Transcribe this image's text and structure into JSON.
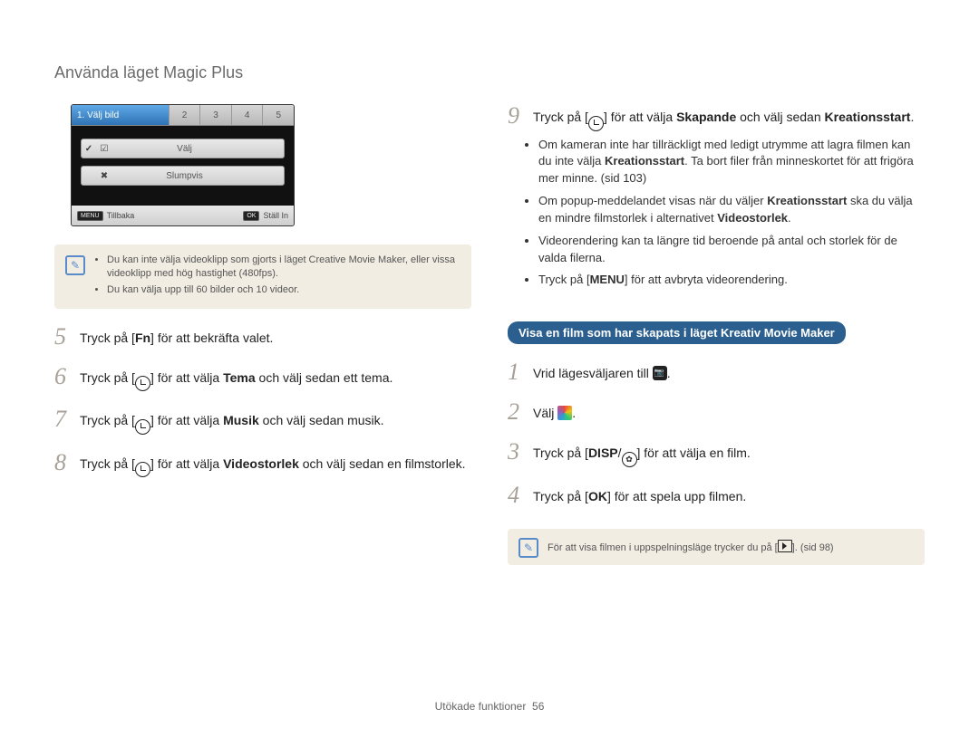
{
  "header": {
    "title": "Använda läget Magic Plus"
  },
  "cam_ui": {
    "tabs": {
      "active": "1. Välj bild",
      "others": [
        "2",
        "3",
        "4",
        "5"
      ]
    },
    "rows": [
      {
        "mark": "✓",
        "icon": "☑",
        "label": "Välj"
      },
      {
        "mark": "✖",
        "icon": "✖",
        "label": "Slumpvis"
      }
    ],
    "footer": {
      "menu_btn": "MENU",
      "back": "Tillbaka",
      "ok_btn": "OK",
      "set": "Ställ In"
    }
  },
  "note1": {
    "items": [
      "Du kan inte välja videoklipp som gjorts i läget Creative Movie Maker, eller vissa videoklipp med hög hastighet (480fps).",
      "Du kan välja upp till 60 bilder och 10 videor."
    ]
  },
  "steps_left": [
    {
      "n": "5",
      "pre": "Tryck på [",
      "key": "Fn",
      "post": "] för att bekräfta valet."
    },
    {
      "n": "6",
      "pre": "Tryck på [",
      "key_type": "timer",
      "mid": "] för att välja ",
      "bold": "Tema",
      "post": " och välj sedan ett tema."
    },
    {
      "n": "7",
      "pre": "Tryck på [",
      "key_type": "timer",
      "mid": "] för att välja ",
      "bold": "Musik",
      "post": " och välj sedan musik."
    },
    {
      "n": "8",
      "pre": "Tryck på [",
      "key_type": "timer",
      "mid": "] för att välja ",
      "bold": "Videostorlek",
      "post": " och välj sedan en filmstorlek."
    }
  ],
  "step9": {
    "n": "9",
    "pre": "Tryck på [",
    "mid1": "] för att välja ",
    "bold1": "Skapande",
    "mid2": " och välj sedan ",
    "bold2": "Kreationsstart",
    "post": ".",
    "sub": [
      {
        "t1": "Om kameran inte har tillräckligt med ledigt utrymme att lagra filmen kan du inte välja ",
        "b1": "Kreationsstart",
        "t2": ". Ta bort filer från minneskortet för att frigöra mer minne. (sid 103)"
      },
      {
        "t1": "Om popup-meddelandet visas när du väljer ",
        "b1": "Kreationsstart",
        "t2": " ska du välja en mindre filmstorlek i alternativet ",
        "b2": "Videostorlek",
        "t3": "."
      },
      {
        "t1": "Videorendering kan ta längre tid beroende på antal och storlek för de valda filerna."
      },
      {
        "t1": "Tryck på [",
        "key": "MENU",
        "t2": "] för att avbryta videorendering."
      }
    ]
  },
  "section": {
    "title": "Visa en film som har skapats i läget Kreativ Movie Maker"
  },
  "steps_right": [
    {
      "n": "1",
      "text": "Vrid lägesväljaren till ",
      "icon": "dial",
      "post": "."
    },
    {
      "n": "2",
      "text": "Välj ",
      "icon": "color",
      "post": "."
    },
    {
      "n": "3",
      "pre": "Tryck på [",
      "key": "DISP",
      "sep": "/",
      "key2_type": "flower",
      "post": "] för att välja en film."
    },
    {
      "n": "4",
      "pre": "Tryck på [",
      "key": "OK",
      "post": "] för att spela upp filmen."
    }
  ],
  "note2": {
    "pre": "För att visa filmen i uppspelningsläge trycker du på [",
    "post": "]. (sid 98)"
  },
  "footer": {
    "section": "Utökade funktioner",
    "page": "56"
  }
}
